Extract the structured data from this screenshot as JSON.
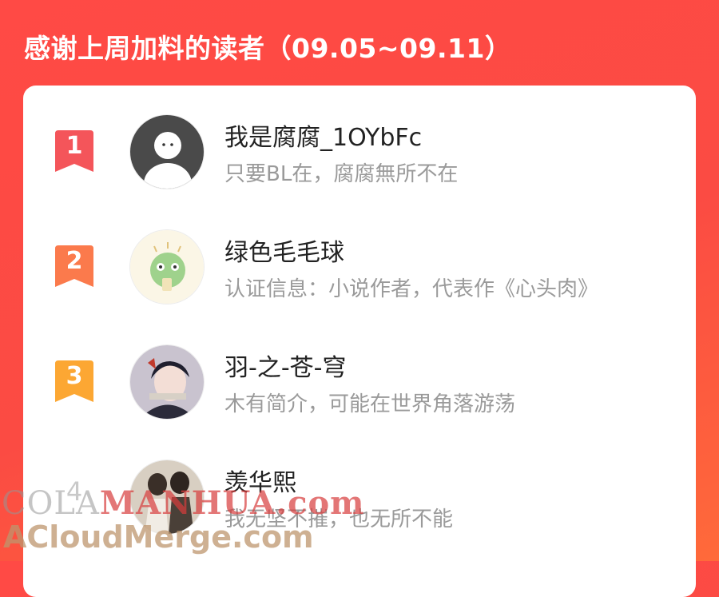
{
  "header": {
    "title": "感谢上周加料的读者（09.05~09.11）"
  },
  "readers": [
    {
      "rank": "1",
      "name": "我是腐腐_1OYbFc",
      "desc": "只要BL在，腐腐無所不在",
      "badge_color": "#f4555a"
    },
    {
      "rank": "2",
      "name": "绿色毛毛球",
      "desc": "认证信息：小说作者，代表作《心头肉》",
      "badge_color": "#fb7a4c"
    },
    {
      "rank": "3",
      "name": "羽-之-苍-穹",
      "desc": "木有简介，可能在世界角落游荡",
      "badge_color": "#fca733"
    },
    {
      "rank": "4",
      "name": "羡华熙",
      "desc": "我无坚不摧，也无所不能",
      "badge_color": ""
    }
  ],
  "watermark": {
    "line1_gray": "COLA",
    "line1_red": "MANHUA.com",
    "line2": "ACloudMerge.com"
  }
}
